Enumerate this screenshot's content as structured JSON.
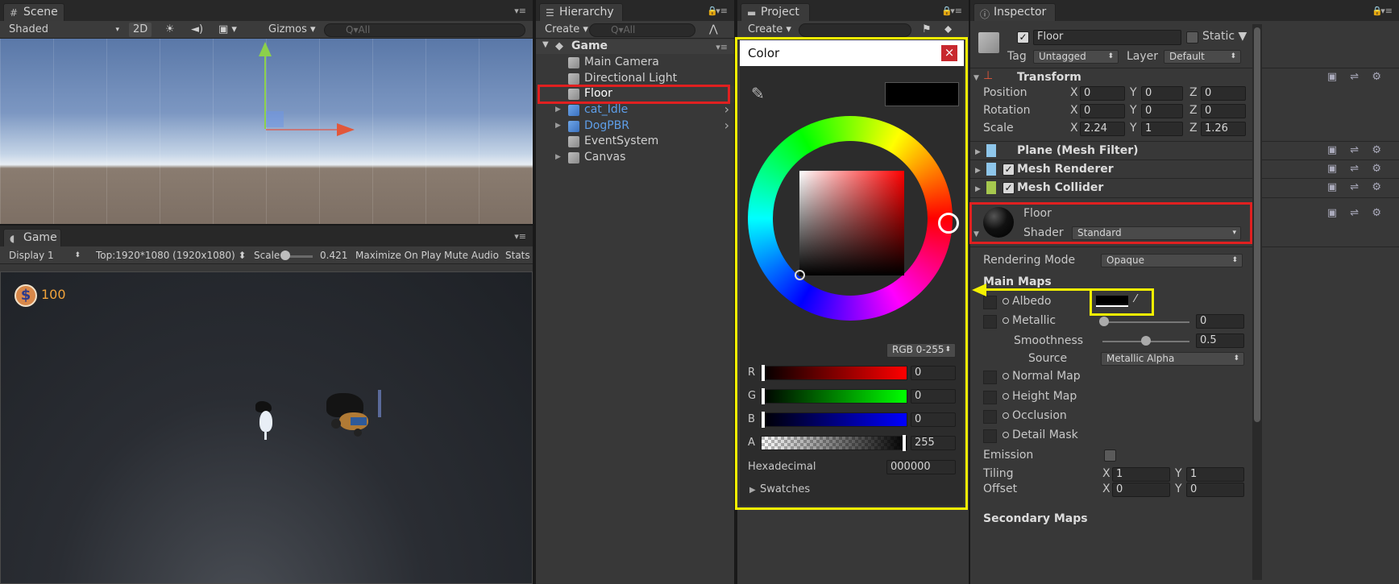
{
  "scene": {
    "tab": "Scene",
    "shading": "Shaded",
    "btn_2d": "2D",
    "gizmos": "Gizmos",
    "search_placeholder": "Q▾All"
  },
  "game": {
    "tab": "Game",
    "display": "Display 1",
    "resolution": "Top:1920*1080 (1920x1080)",
    "scale_label": "Scale",
    "scale_value": "0.421",
    "maximize": "Maximize On Play",
    "mute": "Mute Audio",
    "stats": "Stats",
    "coins": "100",
    "coin_glyph": "$"
  },
  "hierarchy": {
    "tab": "Hierarchy",
    "create": "Create",
    "search_placeholder": "Q▾All",
    "root": "Game",
    "items": [
      {
        "label": "Main Camera",
        "prefab": false,
        "expandable": false
      },
      {
        "label": "Directional Light",
        "prefab": false,
        "expandable": false
      },
      {
        "label": "Floor",
        "prefab": false,
        "expandable": false,
        "selected": true
      },
      {
        "label": "cat_Idle",
        "prefab": true,
        "expandable": true
      },
      {
        "label": "DogPBR",
        "prefab": true,
        "expandable": true
      },
      {
        "label": "EventSystem",
        "prefab": false,
        "expandable": false
      },
      {
        "label": "Canvas",
        "prefab": false,
        "expandable": true
      }
    ]
  },
  "project": {
    "tab": "Project",
    "create": "Create"
  },
  "color_picker": {
    "title": "Color",
    "close": "×",
    "mode": "RGB 0-255",
    "channels": [
      {
        "label": "R",
        "value": "0"
      },
      {
        "label": "G",
        "value": "0"
      },
      {
        "label": "B",
        "value": "0"
      },
      {
        "label": "A",
        "value": "255"
      }
    ],
    "hex_label": "Hexadecimal",
    "hex_value": "000000",
    "swatches": "Swatches",
    "current_color": "#000000"
  },
  "inspector": {
    "tab": "Inspector",
    "object_name": "Floor",
    "static_label": "Static",
    "tag_label": "Tag",
    "tag_value": "Untagged",
    "layer_label": "Layer",
    "layer_value": "Default",
    "transform": {
      "title": "Transform",
      "position_label": "Position",
      "rotation_label": "Rotation",
      "scale_label": "Scale",
      "position": {
        "x": "0",
        "y": "0",
        "z": "0"
      },
      "rotation": {
        "x": "0",
        "y": "0",
        "z": "0"
      },
      "scale": {
        "x": "2.24",
        "y": "1",
        "z": "1.26"
      }
    },
    "components": [
      "Plane (Mesh Filter)",
      "Mesh Renderer",
      "Mesh Collider"
    ],
    "material": {
      "name": "Floor",
      "shader_label": "Shader",
      "shader_value": "Standard"
    },
    "rendering_mode_label": "Rendering Mode",
    "rendering_mode_value": "Opaque",
    "main_maps": "Main Maps",
    "albedo": "Albedo",
    "metallic": "Metallic",
    "metallic_value": "0",
    "smoothness": "Smoothness",
    "smoothness_value": "0.5",
    "source_label": "Source",
    "source_value": "Metallic Alpha",
    "normal_map": "Normal Map",
    "height_map": "Height Map",
    "occlusion": "Occlusion",
    "detail_mask": "Detail Mask",
    "emission": "Emission",
    "tiling_label": "Tiling",
    "offset_label": "Offset",
    "tiling": {
      "x": "1",
      "y": "1"
    },
    "offset": {
      "x": "0",
      "y": "0"
    },
    "secondary_maps": "Secondary Maps"
  },
  "axis_labels": {
    "x": "X",
    "y": "Y",
    "z": "Z"
  },
  "colors": {
    "highlight_red": "#e02020",
    "highlight_yellow": "#f4f100"
  },
  "icons": [
    "grid-icon",
    "hierarchy-icon",
    "folder-icon",
    "info-icon",
    "unity-logo-icon",
    "eyedropper-icon",
    "lock-icon",
    "menu-icon",
    "help-icon",
    "settings-icon",
    "coin-icon"
  ]
}
